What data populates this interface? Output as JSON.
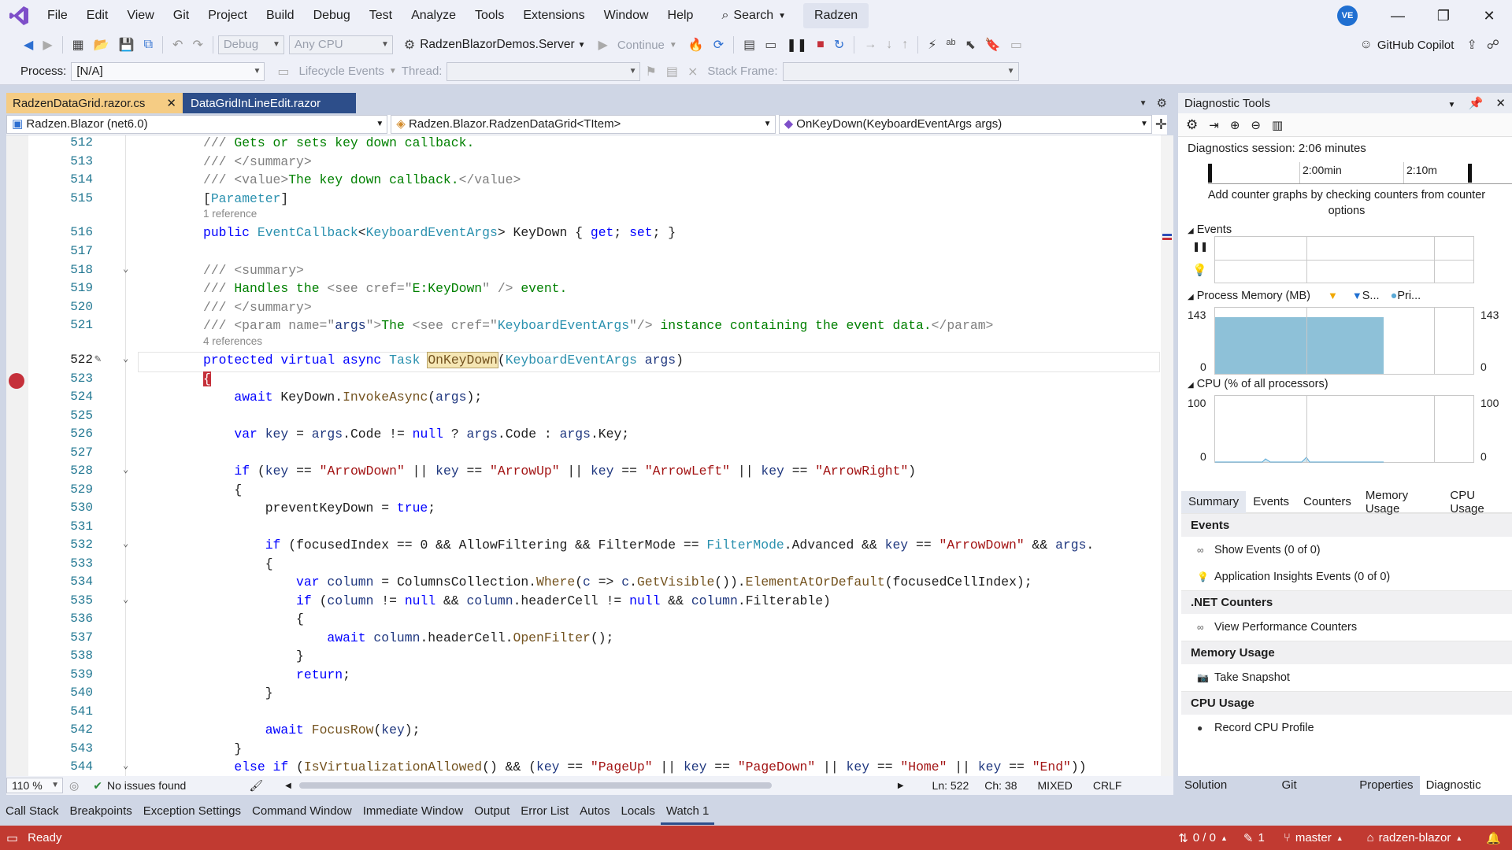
{
  "app": {
    "menu": [
      "File",
      "Edit",
      "View",
      "Git",
      "Project",
      "Build",
      "Debug",
      "Test",
      "Analyze",
      "Tools",
      "Extensions",
      "Window",
      "Help"
    ],
    "search_label": "Search",
    "solution_name": "Radzen",
    "avatar_initials": "VE"
  },
  "toolbar": {
    "config": "Debug",
    "platform": "Any CPU",
    "startup_project": "RadzenBlazorDemos.Server",
    "continue_label": "Continue",
    "copilot_label": "GitHub Copilot",
    "process_label": "Process:",
    "process_value": "[N/A]",
    "lifecycle_label": "Lifecycle Events",
    "thread_label": "Thread:",
    "stack_frame_label": "Stack Frame:"
  },
  "editor": {
    "tabs": [
      {
        "label": "RadzenDataGrid.razor.cs",
        "active": true
      },
      {
        "label": "DataGridInLineEdit.razor",
        "active": false
      }
    ],
    "nav": {
      "project": "Radzen.Blazor (net6.0)",
      "type": "Radzen.Blazor.RadzenDataGrid<TItem>",
      "member": "OnKeyDown(KeyboardEventArgs args)"
    },
    "hints": {
      "h1": "1 reference",
      "h2": "4 references"
    },
    "zoom": "110 %",
    "issues": "No issues found",
    "ln": "Ln: 522",
    "ch": "Ch: 38",
    "encoding": "MIXED",
    "eol": "CRLF"
  },
  "diagnostics": {
    "title": "Diagnostic Tools",
    "session": "Diagnostics session: 2:06 minutes",
    "ruler_ticks": [
      "2:00min",
      "2:10m"
    ],
    "counter_hint": "Add counter graphs by checking counters from counter options",
    "events_label": "Events",
    "memory_label": "Process Memory (MB)",
    "memory_legend": [
      "S...",
      "Pri..."
    ],
    "memory_max": "143",
    "memory_min": "0",
    "cpu_label": "CPU (% of all processors)",
    "cpu_max": "100",
    "cpu_min": "0",
    "tabs": [
      "Summary",
      "Events",
      "Counters",
      "Memory Usage",
      "CPU Usage"
    ],
    "groups": [
      {
        "title": "Events",
        "items": [
          "Show Events (0 of 0)",
          "Application Insights Events (0 of 0)"
        ]
      },
      {
        "title": ".NET Counters",
        "items": [
          "View Performance Counters"
        ]
      },
      {
        "title": "Memory Usage",
        "items": [
          "Take Snapshot"
        ]
      },
      {
        "title": "CPU Usage",
        "items": [
          "Record CPU Profile"
        ]
      }
    ]
  },
  "dock_tabs": [
    "Solution Explo...",
    "Git Changes",
    "Properties",
    "Diagnostic To..."
  ],
  "tool_windows": [
    "Call Stack",
    "Breakpoints",
    "Exception Settings",
    "Command Window",
    "Immediate Window",
    "Output",
    "Error List",
    "Autos",
    "Locals",
    "Watch 1"
  ],
  "status": {
    "ready": "Ready",
    "changes": "0 / 0",
    "edits": "1",
    "branch": "master",
    "repo": "radzen-blazor"
  },
  "colors": {
    "status_bar": "#c13a31",
    "tab_active": "#f5cc84",
    "tab_inactive": "#2d4e8a",
    "breakpoint": "#c5303a",
    "memory_fill": "#8ec1d8"
  }
}
